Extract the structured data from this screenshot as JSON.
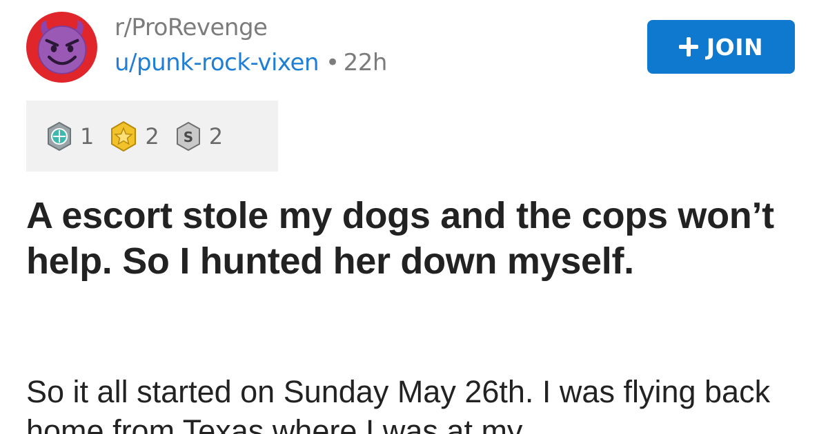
{
  "header": {
    "subreddit": "r/ProRevenge",
    "username": "u/punk-rock-vixen",
    "separator": "•",
    "age": "22h",
    "avatar_icon": "devil-emoji-icon"
  },
  "join_button": {
    "label": "JOIN",
    "icon": "plus-icon",
    "color": "#0f79d0"
  },
  "awards": [
    {
      "icon": "platinum-award-icon",
      "count": "1"
    },
    {
      "icon": "gold-award-icon",
      "count": "2"
    },
    {
      "icon": "silver-award-icon",
      "count": "2"
    }
  ],
  "post": {
    "title": "A escort stole my dogs and the cops won’t help. So I hunted her down myself.",
    "body": "So it all started on Sunday May 26th. I was flying back home from Texas where I was at my"
  },
  "colors": {
    "link": "#1f7fd6",
    "muted": "#7c7c7c",
    "avatar_bg": "#e0262b",
    "award_bg": "#f1f1f1"
  }
}
